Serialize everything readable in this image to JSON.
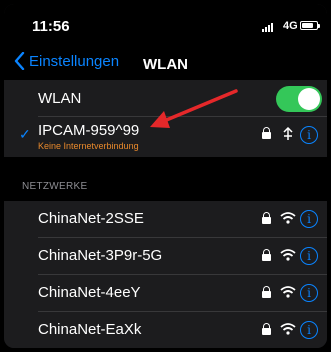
{
  "status": {
    "time": "11:56",
    "network": "4G",
    "signal_bars": 4,
    "battery_level": 0.75
  },
  "nav": {
    "back_label": "Einstellungen",
    "title": "WLAN"
  },
  "wlan": {
    "label": "WLAN",
    "enabled": true
  },
  "connected": {
    "name": "IPCAM-959^99",
    "status": "Keine Internetverbindung"
  },
  "section_header": "NETZWERKE",
  "networks": [
    {
      "name": "ChinaNet-2SSE"
    },
    {
      "name": "ChinaNet-3P9r-5G"
    },
    {
      "name": "ChinaNet-4eeY"
    },
    {
      "name": "ChinaNet-EaXk"
    }
  ],
  "icons": {
    "info": "i",
    "check": "✓"
  },
  "colors": {
    "accent": "#0a84ff",
    "toggle_on": "#34c759",
    "warning": "#e8892c",
    "annotation_arrow": "#e5282a"
  }
}
